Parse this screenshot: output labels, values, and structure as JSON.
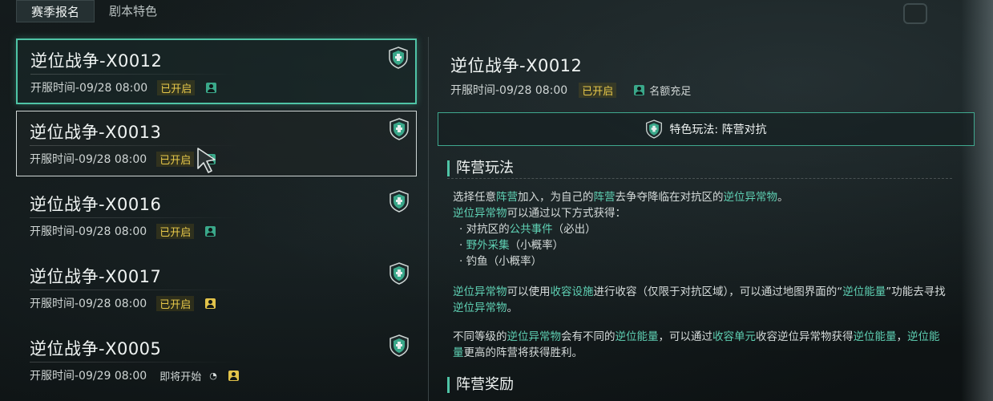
{
  "tabs": [
    {
      "label": "赛季报名",
      "active": true
    },
    {
      "label": "剧本特色",
      "active": false
    }
  ],
  "servers": [
    {
      "name": "逆位战争-X0012",
      "open_time": "开服时间-09/28 08:00",
      "status": "已开启",
      "status_type": "open",
      "icon_color": "green",
      "selected": true
    },
    {
      "name": "逆位战争-X0013",
      "open_time": "开服时间-09/28 08:00",
      "status": "已开启",
      "status_type": "open",
      "icon_color": "green",
      "hovered": true
    },
    {
      "name": "逆位战争-X0016",
      "open_time": "开服时间-09/28 08:00",
      "status": "已开启",
      "status_type": "open",
      "icon_color": "green"
    },
    {
      "name": "逆位战争-X0017",
      "open_time": "开服时间-09/28 08:00",
      "status": "已开启",
      "status_type": "open",
      "icon_color": "yellow"
    },
    {
      "name": "逆位战争-X0005",
      "open_time": "开服时间-09/29 08:00",
      "status": "即将开始",
      "status_type": "soon",
      "icon_color": "yellow",
      "clock": "◔"
    }
  ],
  "detail": {
    "title": "逆位战争-X0012",
    "open_time": "开服时间-09/28 08:00",
    "status": "已开启",
    "quota": "名额充足",
    "feature": "特色玩法: 阵营对抗",
    "section1_title": "阵营玩法",
    "section2_title": "阵营奖励",
    "p1": [
      {
        "t": "选择任意"
      },
      {
        "t": "阵营",
        "h": true
      },
      {
        "t": "加入，为自己的"
      },
      {
        "t": "阵营",
        "h": true
      },
      {
        "t": "去争夺降临在对抗区的"
      },
      {
        "t": "逆位异常物",
        "h": true
      },
      {
        "t": "。"
      }
    ],
    "p2": [
      {
        "t": "逆位异常物",
        "h": true
      },
      {
        "t": "可以通过以下方式获得："
      }
    ],
    "bullets": [
      [
        {
          "t": "· 对抗区的"
        },
        {
          "t": "公共事件",
          "h": true
        },
        {
          "t": "（必出）"
        }
      ],
      [
        {
          "t": "· "
        },
        {
          "t": "野外采集",
          "h": true
        },
        {
          "t": "（小概率）"
        }
      ],
      [
        {
          "t": "· 钓鱼（小概率）"
        }
      ]
    ],
    "p3": [
      {
        "t": "逆位异常物",
        "h": true
      },
      {
        "t": "可以使用"
      },
      {
        "t": "收容设施",
        "h": true
      },
      {
        "t": "进行收容（仅限于对抗区域），可以通过地图界面的“"
      },
      {
        "t": "逆位能量",
        "h": true
      },
      {
        "t": "”功能去寻找"
      },
      {
        "t": "逆位异常物",
        "h": true
      },
      {
        "t": "。"
      }
    ],
    "p4": [
      {
        "t": "不同等级的"
      },
      {
        "t": "逆位异常物",
        "h": true
      },
      {
        "t": "会有不同的"
      },
      {
        "t": "逆位能量",
        "h": true
      },
      {
        "t": "，可以通过"
      },
      {
        "t": "收容单元",
        "h": true
      },
      {
        "t": "收容逆位异常物获得"
      },
      {
        "t": "逆位能量",
        "h": true
      },
      {
        "t": "，"
      },
      {
        "t": "逆位能量",
        "h": true
      },
      {
        "t": "更高的阵营将获得胜利。"
      }
    ]
  },
  "colors": {
    "accent": "#4fc4a6",
    "highlight": "#5fd1b4",
    "status_open": "#e8c94a"
  },
  "icons": {
    "shield": "shield-icon",
    "person": "person-icon",
    "cursor": "cursor-icon"
  }
}
